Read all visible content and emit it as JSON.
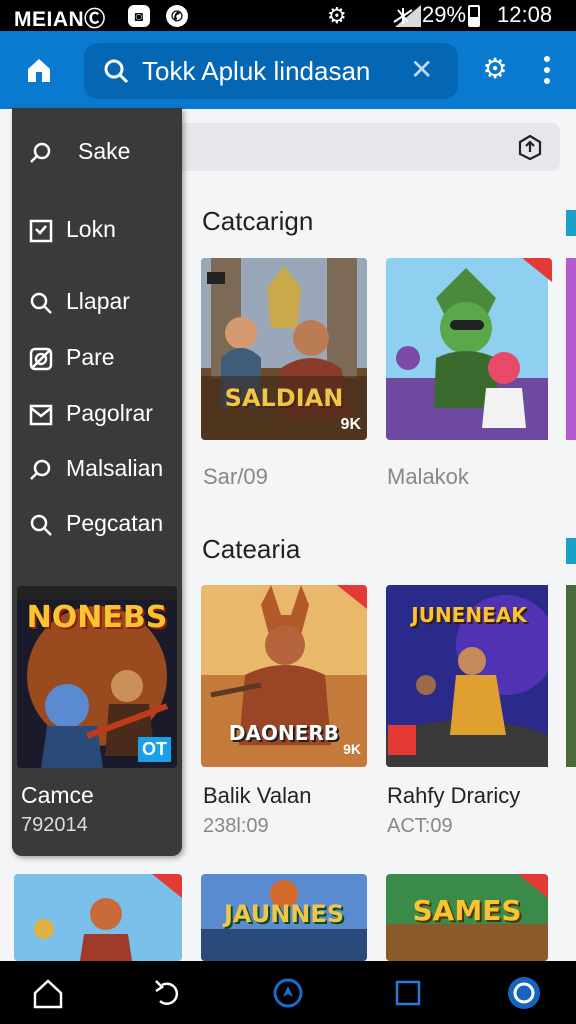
{
  "status_bar": {
    "brand": "MEIANⒸ",
    "battery_pct": "29%",
    "time": "12:08"
  },
  "app_bar": {
    "search_text": "Tokk Apluk lindasan"
  },
  "drawer": {
    "items": [
      {
        "label": "Sake",
        "icon": "search-icon"
      },
      {
        "label": "Lokn",
        "icon": "checkbox-icon"
      },
      {
        "label": "Llapar",
        "icon": "search-icon"
      },
      {
        "label": "Pare",
        "icon": "blocked-icon"
      },
      {
        "label": "Pagolrar",
        "icon": "mail-icon"
      },
      {
        "label": "Malsalian",
        "icon": "search-icon"
      },
      {
        "label": "Pegcatan",
        "icon": "search-icon"
      }
    ],
    "featured": {
      "art_title": "NONEBS",
      "badge": "OT",
      "name": "Camce",
      "sub": "792014"
    }
  },
  "sections": [
    {
      "title": "Catcarign",
      "cards": [
        {
          "art_title": "SALDIAN",
          "badge": "9K",
          "label": "Sar/09",
          "sub": ""
        },
        {
          "art_title": "",
          "badge": "",
          "label": "Malakok",
          "sub": ""
        }
      ]
    },
    {
      "title": "Catearia",
      "cards": [
        {
          "art_title": "DAONERB",
          "badge": "9K",
          "label": "Balik Valan",
          "sub": "238l:09"
        },
        {
          "art_title": "JUNENEAK",
          "badge": "",
          "label": "Rahfy Draricy",
          "sub": "ACT:09"
        }
      ]
    },
    {
      "title": "",
      "cards": [
        {
          "art_title": "",
          "label": "",
          "sub": ""
        },
        {
          "art_title": "JAUNNES",
          "label": "",
          "sub": ""
        },
        {
          "art_title": "SAMES",
          "label": "",
          "sub": ""
        }
      ]
    }
  ],
  "colors": {
    "appbar": "#0a7ad0",
    "search_field": "#0566b4",
    "drawer": "#3a3a3a",
    "accent": "#1565c0"
  }
}
